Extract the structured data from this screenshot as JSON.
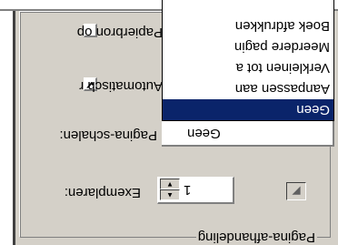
{
  "group": {
    "title": "Pagina-afhandeling"
  },
  "copies": {
    "label": "Exemplaren:",
    "value": "1"
  },
  "scaling": {
    "label": "Pagina-schalen:",
    "value": "Geen",
    "options": [
      "Geen",
      "Aanpassen aan",
      "Verkleinen tot a",
      "Meerdere pagin",
      "Boek afdrukken"
    ],
    "selected_index": 0
  },
  "auto_rotate": {
    "label": "Automatisch r",
    "checked": true
  },
  "paper_source": {
    "label": "Papierbron op",
    "checked": false
  },
  "icons": {
    "spin_up": "arrow-up-icon",
    "spin_down": "arrow-down-icon",
    "extra_button": "triangle-icon",
    "check_mark": "checkmark-icon"
  },
  "colors": {
    "selection": "#0a246a",
    "face": "#d4d0c8"
  }
}
